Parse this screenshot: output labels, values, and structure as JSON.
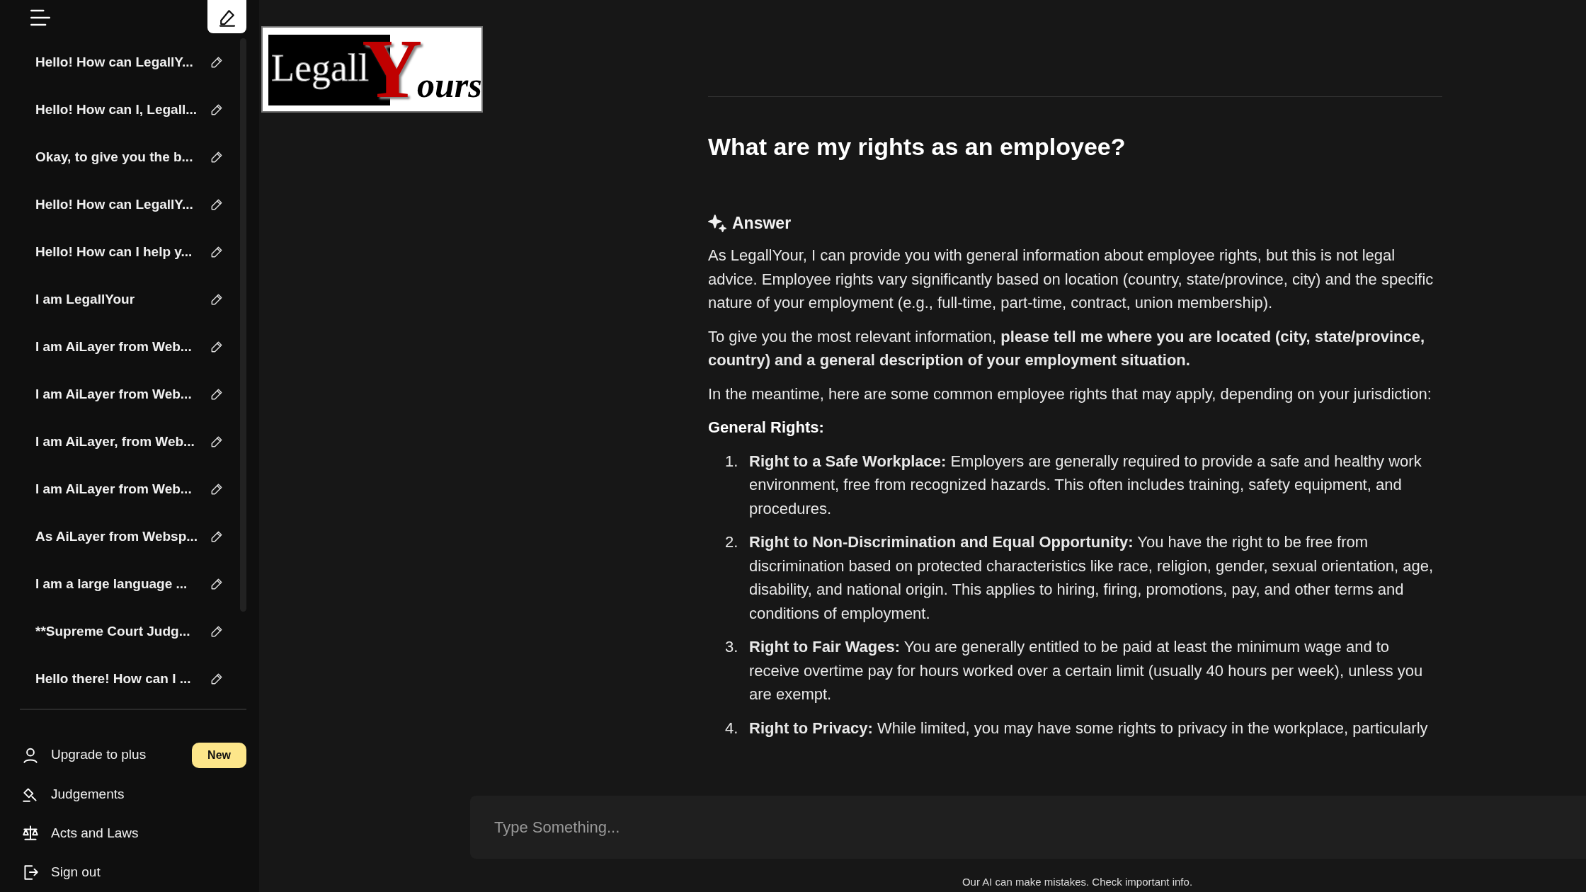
{
  "sidebar": {
    "chats": [
      {
        "title": "Hello! How can LegallY..."
      },
      {
        "title": "Hello! How can I, Legall..."
      },
      {
        "title": "Okay, to give you the b..."
      },
      {
        "title": "Hello! How can LegallY..."
      },
      {
        "title": "Hello! How can I help y..."
      },
      {
        "title": "I am LegallYour"
      },
      {
        "title": "I am AiLayer from Web..."
      },
      {
        "title": "I am AiLayer from Web..."
      },
      {
        "title": "I am AiLayer, from Web..."
      },
      {
        "title": "I am AiLayer from Web..."
      },
      {
        "title": "As AiLayer from Websp..."
      },
      {
        "title": "I am a large language ..."
      },
      {
        "title": "**Supreme Court Judg..."
      },
      {
        "title": "Hello there! How can I ..."
      }
    ],
    "menu": [
      {
        "kind": "upgrade",
        "label": "Upgrade to plus",
        "badge": "New"
      },
      {
        "kind": "judgements",
        "label": "Judgements"
      },
      {
        "kind": "acts",
        "label": "Acts and Laws"
      },
      {
        "kind": "signout",
        "label": "Sign out"
      }
    ]
  },
  "logo": {
    "parts": [
      "Legall",
      "Y",
      "ours"
    ]
  },
  "question": "What are my rights as an employee?",
  "answer": {
    "label": "Answer",
    "paragraphs": [
      "As LegallYour, I can provide you with general information about employee rights, but this is not legal advice. Employee rights vary significantly based on location (country, state/province, city) and the specific nature of your employment (e.g., full-time, part-time, contract, union membership).",
      "To give you the most relevant information, **please tell me where you are located (city, state/province, country) and a general description of your employment situation.**",
      "In the meantime, here are some common employee rights that may apply, depending on your jurisdiction:"
    ],
    "section": "General Rights:",
    "items": [
      {
        "number": "1.",
        "text": "**Right to a Safe Workplace:** Employers are generally required to provide a safe and healthy work environment, free from recognized hazards. This often includes training, safety equipment, and procedures."
      },
      {
        "number": "2.",
        "text": "**Right to Non-Discrimination and Equal Opportunity:** You have the right to be free from discrimination based on protected characteristics like race, religion, gender, sexual orientation, age, disability, and national origin. This applies to hiring, firing, promotions, pay, and other terms and conditions of employment."
      },
      {
        "number": "3.",
        "text": "**Right to Fair Wages:** You are generally entitled to be paid at least the minimum wage and to receive overtime pay for hours worked over a certain limit (usually 40 hours per week), unless you are exempt."
      },
      {
        "number": "4.",
        "text": "**Right to Privacy:** While limited, you may have some rights to privacy in the workplace, particularly"
      }
    ]
  },
  "input": {
    "placeholder": "Type Something..."
  },
  "footer": "Our AI can make mistakes. Check important info."
}
